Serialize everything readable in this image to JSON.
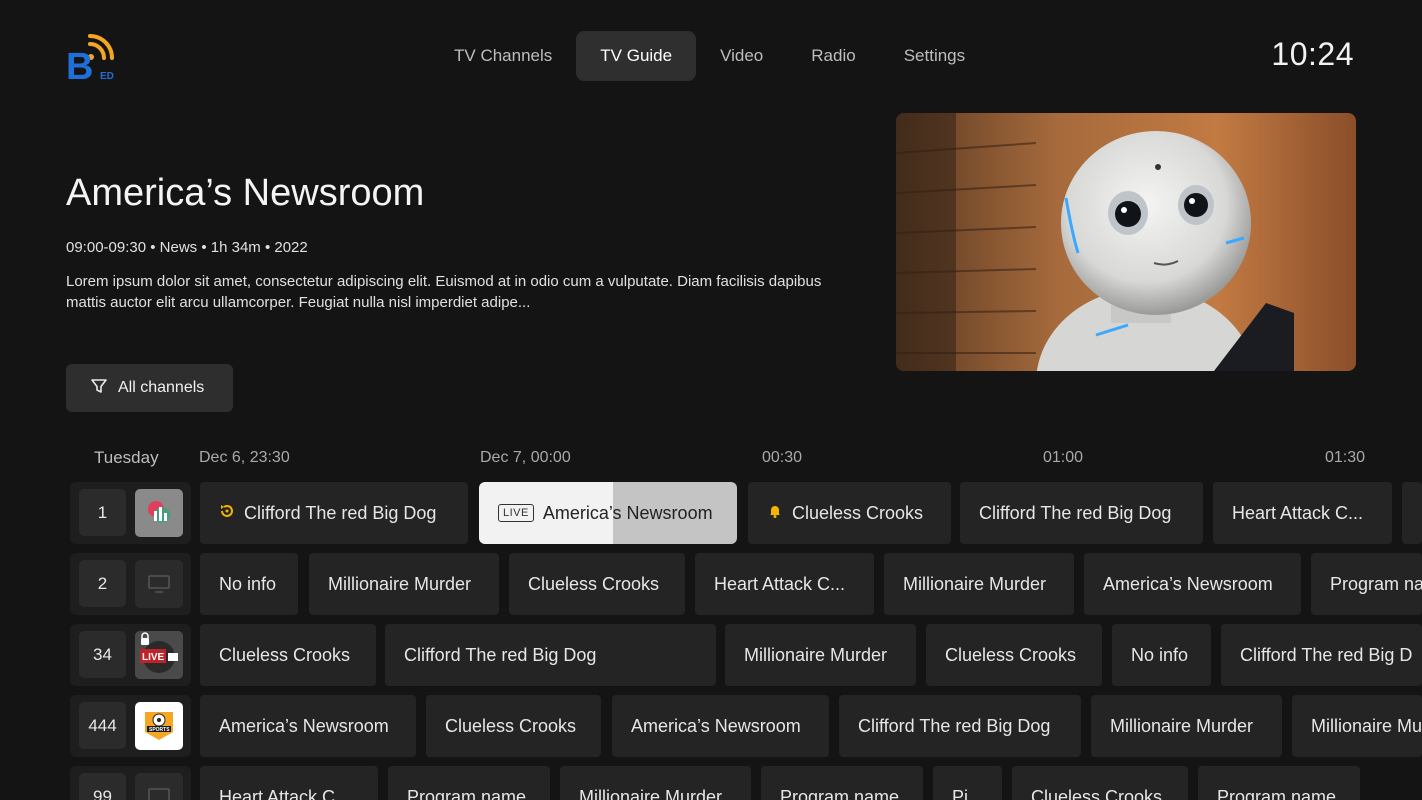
{
  "header": {
    "nav": [
      "TV Channels",
      "TV Guide",
      "Video",
      "Radio",
      "Settings"
    ],
    "active_nav": "TV Guide",
    "clock": "10:24",
    "logo_text": "B"
  },
  "hero": {
    "title": "America’s Newsroom",
    "meta": "09:00-09:30 • News  • 1h 34m • 2022",
    "description": "Lorem ipsum dolor sit amet, consectetur adipiscing elit. Euismod at in odio cum a vulputate. Diam facilisis dapibus mattis auctor elit arcu ullamcorper. Feugiat nulla nisl imperdiet adipe...",
    "filter_label": "All channels"
  },
  "timeline": {
    "day": "Tuesday",
    "times": [
      "Dec 6, 23:30",
      "Dec 7, 00:00",
      "00:30",
      "01:00",
      "01:30"
    ]
  },
  "channels": [
    {
      "number": "1",
      "logo": "chart-logo",
      "programs": [
        {
          "title": "Clifford The red Big Dog",
          "icon": "replay-icon"
        },
        {
          "title": "America’s Newsroom",
          "badge": "LIVE",
          "focused": true
        },
        {
          "title": "Clueless Crooks",
          "icon": "bell-icon"
        },
        {
          "title": "Clifford The red Big Dog"
        },
        {
          "title": "Heart Attack C..."
        },
        {
          "title": ""
        }
      ]
    },
    {
      "number": "2",
      "logo": "monitor-icon",
      "programs": [
        {
          "title": "No info"
        },
        {
          "title": "Millionaire Murder"
        },
        {
          "title": "Clueless Crooks"
        },
        {
          "title": "Heart Attack C..."
        },
        {
          "title": "Millionaire Murder"
        },
        {
          "title": "America’s Newsroom"
        },
        {
          "title": "Program na"
        }
      ]
    },
    {
      "number": "34",
      "logo": "live-hd-logo",
      "logo_text": "LIVE",
      "programs": [
        {
          "title": "Clueless Crooks"
        },
        {
          "title": "Clifford The red Big Dog"
        },
        {
          "title": "Millionaire Murder"
        },
        {
          "title": "Clueless Crooks"
        },
        {
          "title": "No info"
        },
        {
          "title": "Clifford The red Big D"
        }
      ]
    },
    {
      "number": "444",
      "logo": "sports-news-logo",
      "logo_text": "SPORTS",
      "programs": [
        {
          "title": "America’s Newsroom"
        },
        {
          "title": "Clueless Crooks"
        },
        {
          "title": "America’s Newsroom"
        },
        {
          "title": "Clifford The red Big Dog"
        },
        {
          "title": "Millionaire Murder"
        },
        {
          "title": "Millionaire Mu"
        }
      ]
    },
    {
      "number": "99",
      "logo": "monitor-icon",
      "programs": [
        {
          "title": "Heart Attack C..."
        },
        {
          "title": "Program name"
        },
        {
          "title": "Millionaire Murder"
        },
        {
          "title": "Program name"
        },
        {
          "title": "Pi"
        },
        {
          "title": "Clueless Crooks"
        },
        {
          "title": "Program name"
        }
      ]
    }
  ],
  "colors": {
    "background": "#141414",
    "nav_active": "#2f2f2f",
    "program_bg": "#242424",
    "logo_blue": "#1e6fd9",
    "logo_orange": "#f5a623"
  }
}
